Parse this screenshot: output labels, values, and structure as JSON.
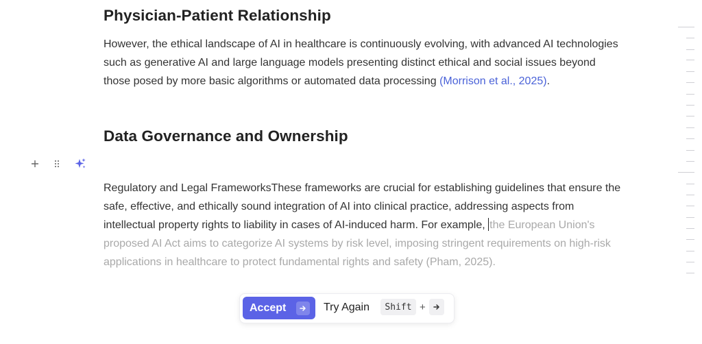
{
  "sections": [
    {
      "heading": "Physician-Patient Relationship",
      "body": "However, the ethical landscape of AI in healthcare is continuously evolving, with advanced AI technologies such as generative AI and large language models presenting distinct ethical and social issues beyond those posed by more basic algorithms or automated data processing",
      "citation": "(Morrison et al., 2025)",
      "trailing": "."
    },
    {
      "heading": "Data Governance and Ownership"
    }
  ],
  "block": {
    "body": "Regulatory and Legal FrameworksThese frameworks are crucial for establishing guidelines that ensure the safe, effective, and ethically sound integration of AI into clinical practice, addressing aspects from intellectual property rights to liability in cases of AI-induced harm. For example, ",
    "suggestion": "the European Union's proposed AI Act aims to categorize AI systems by risk level, imposing stringent requirements on high-risk applications in healthcare to protect fundamental rights and safety (Pham, 2025)."
  },
  "gutter_icons": [
    "plus-icon",
    "drag-handle-icon",
    "sparkles-icon"
  ],
  "suggestion_bar": {
    "accept_label": "Accept",
    "accept_icon": "arrow-right-icon",
    "try_again_label": "Try Again",
    "shortcut_key": "Shift",
    "shortcut_plus": "+",
    "shortcut_icon": "arrow-right-icon"
  },
  "colors": {
    "accent": "#5b63e6",
    "citation": "#4a62d8",
    "suggestion_text": "#a9a9a9"
  }
}
